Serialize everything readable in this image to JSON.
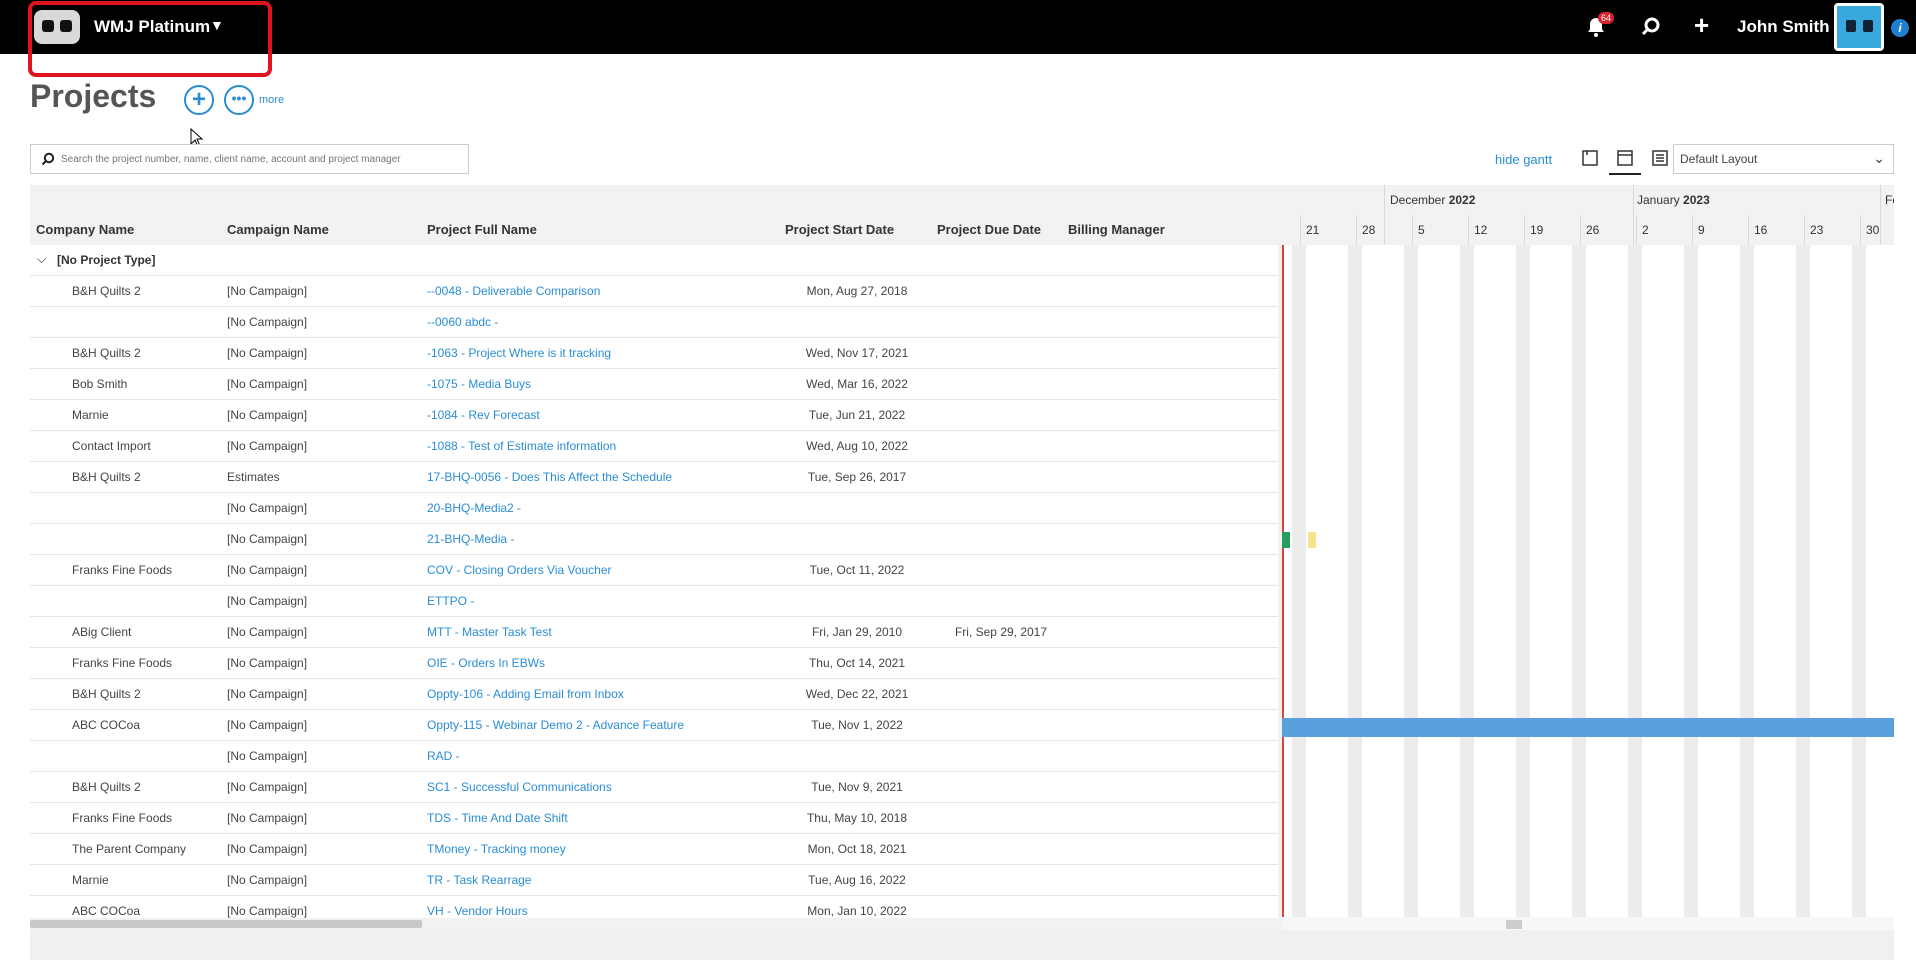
{
  "topbar": {
    "brand": "WMJ Platinum",
    "notification_count": "64",
    "user_name": "John Smith",
    "info_label": "i"
  },
  "page": {
    "title": "Projects",
    "add_symbol": "+",
    "more_symbol": "•••",
    "more_label": "more"
  },
  "search": {
    "placeholder": "Search the project number, name, client name, account and project manager"
  },
  "toolbar": {
    "hide_gantt": "hide gantt",
    "layout_value": "Default Layout"
  },
  "columns": [
    "Company Name",
    "Campaign Name",
    "Project Full Name",
    "Project Start Date",
    "Project Due Date",
    "Billing Manager"
  ],
  "group": {
    "label": "[No Project Type]"
  },
  "rows": [
    {
      "company": "B&H Quilts 2",
      "campaign": "[No Campaign]",
      "project": "--0048 - Deliverable Comparison",
      "start": "Mon, Aug 27, 2018",
      "due": ""
    },
    {
      "company": "",
      "campaign": "[No Campaign]",
      "project": "--0060 abdc -",
      "start": "",
      "due": ""
    },
    {
      "company": "B&H Quilts 2",
      "campaign": "[No Campaign]",
      "project": "-1063 - Project Where is it tracking",
      "start": "Wed, Nov 17, 2021",
      "due": ""
    },
    {
      "company": "Bob Smith",
      "campaign": "[No Campaign]",
      "project": "-1075 - Media Buys",
      "start": "Wed, Mar 16, 2022",
      "due": ""
    },
    {
      "company": "Marnie",
      "campaign": "[No Campaign]",
      "project": "-1084 - Rev Forecast",
      "start": "Tue, Jun 21, 2022",
      "due": ""
    },
    {
      "company": "Contact Import",
      "campaign": "[No Campaign]",
      "project": "-1088 - Test of Estimate information",
      "start": "Wed, Aug 10, 2022",
      "due": ""
    },
    {
      "company": "B&H Quilts 2",
      "campaign": "Estimates",
      "project": "17-BHQ-0056 - Does This Affect the Schedule",
      "start": "Tue, Sep 26, 2017",
      "due": ""
    },
    {
      "company": "",
      "campaign": "[No Campaign]",
      "project": "20-BHQ-Media2 -",
      "start": "",
      "due": ""
    },
    {
      "company": "",
      "campaign": "[No Campaign]",
      "project": "21-BHQ-Media -",
      "start": "",
      "due": ""
    },
    {
      "company": "Franks Fine Foods",
      "campaign": "[No Campaign]",
      "project": "COV - Closing Orders Via Voucher",
      "start": "Tue, Oct 11, 2022",
      "due": ""
    },
    {
      "company": "",
      "campaign": "[No Campaign]",
      "project": "ETTPO -",
      "start": "",
      "due": ""
    },
    {
      "company": "ABig Client",
      "campaign": "[No Campaign]",
      "project": "MTT - Master Task Test",
      "start": "Fri, Jan 29, 2010",
      "due": "Fri, Sep 29, 2017"
    },
    {
      "company": "Franks Fine Foods",
      "campaign": "[No Campaign]",
      "project": "OIE - Orders In EBWs",
      "start": "Thu, Oct 14, 2021",
      "due": ""
    },
    {
      "company": "B&H Quilts 2",
      "campaign": "[No Campaign]",
      "project": "Oppty-106 - Adding Email from Inbox",
      "start": "Wed, Dec 22, 2021",
      "due": ""
    },
    {
      "company": "ABC COCoa",
      "campaign": "[No Campaign]",
      "project": "Oppty-115 - Webinar Demo 2 - Advance Feature",
      "start": "Tue, Nov 1, 2022",
      "due": ""
    },
    {
      "company": "",
      "campaign": "[No Campaign]",
      "project": "RAD -",
      "start": "",
      "due": ""
    },
    {
      "company": "B&H Quilts 2",
      "campaign": "[No Campaign]",
      "project": "SC1 - Successful Communications",
      "start": "Tue, Nov 9, 2021",
      "due": ""
    },
    {
      "company": "Franks Fine Foods",
      "campaign": "[No Campaign]",
      "project": "TDS - Time And Date Shift",
      "start": "Thu, May 10, 2018",
      "due": ""
    },
    {
      "company": "The Parent Company",
      "campaign": "[No Campaign]",
      "project": "TMoney - Tracking money",
      "start": "Mon, Oct 18, 2021",
      "due": ""
    },
    {
      "company": "Marnie",
      "campaign": "[No Campaign]",
      "project": "TR - Task Rearrage",
      "start": "Tue, Aug 16, 2022",
      "due": ""
    },
    {
      "company": "ABC COCoa",
      "campaign": "[No Campaign]",
      "project": "VH - Vendor Hours",
      "start": "Mon, Jan 10, 2022",
      "due": ""
    }
  ],
  "gantt": {
    "months": [
      {
        "name": "December",
        "year": "2022"
      },
      {
        "name": "January",
        "year": "2023"
      },
      {
        "name": "Fe",
        "year": ""
      }
    ],
    "days": [
      "21",
      "28",
      "5",
      "12",
      "19",
      "26",
      "2",
      "9",
      "16",
      "23",
      "30"
    ],
    "bar_colors": {
      "green": "#2a9d5c",
      "yellow": "#f5e58a",
      "blue": "#5aa0dc",
      "today": "#d9453c"
    }
  },
  "colors": {
    "link": "#2a8dd4",
    "highlight": "#e0141e",
    "topbar": "#000000"
  }
}
